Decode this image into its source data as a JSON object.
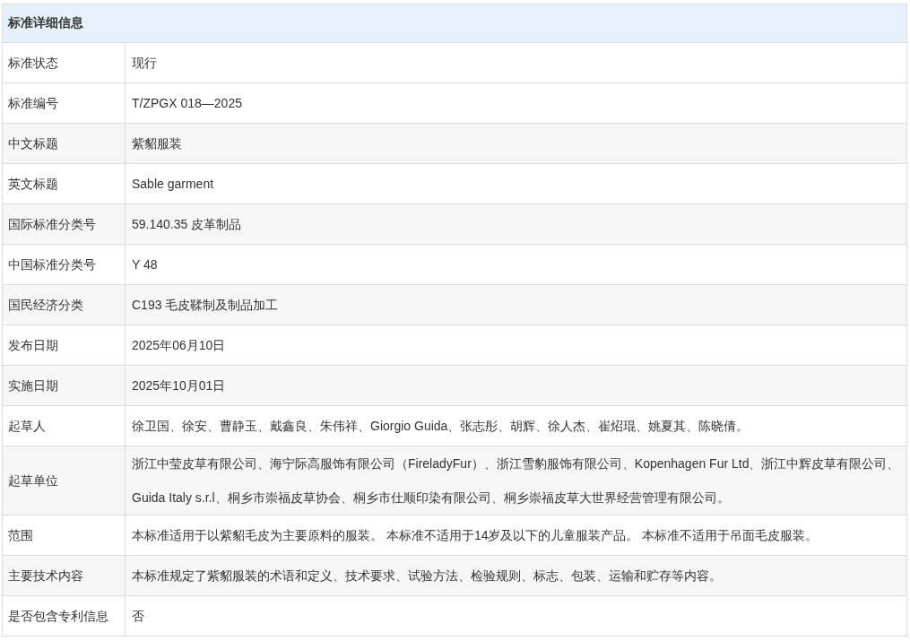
{
  "table": {
    "title": "标准详细信息",
    "rows": [
      {
        "label": "标准状态",
        "value": "现行"
      },
      {
        "label": "标准编号",
        "value": "T/ZPGX 018—2025"
      },
      {
        "label": "中文标题",
        "value": "紫貂服装"
      },
      {
        "label": "英文标题",
        "value": "Sable garment"
      },
      {
        "label": "国际标准分类号",
        "value": "59.140.35 皮革制品"
      },
      {
        "label": "中国标准分类号",
        "value": "Y 48"
      },
      {
        "label": "国民经济分类",
        "value": "C193 毛皮鞣制及制品加工"
      },
      {
        "label": "发布日期",
        "value": "2025年06月10日"
      },
      {
        "label": "实施日期",
        "value": "2025年10月01日"
      },
      {
        "label": "起草人",
        "value": "徐卫国、徐安、曹静玉、戴鑫良、朱伟祥、Giorgio Guida、张志彤、胡辉、徐人杰、崔炤琨、姚夏其、陈晓倩。"
      },
      {
        "label": "起草单位",
        "value": "浙江中莹皮草有限公司、海宁际高服饰有限公司（FireladyFur）、浙江雪豹服饰有限公司、Kopenhagen Fur Ltd、浙江中辉皮草有限公司、Guida Italy s.r.l、桐乡市崇福皮草协会、桐乡市仕顺印染有限公司、桐乡崇福皮草大世界经营管理有限公司。"
      },
      {
        "label": "范围",
        "value": "本标准适用于以紫貂毛皮为主要原料的服装。 本标准不适用于14岁及以下的儿童服装产品。 本标准不适用于吊面毛皮服装。"
      },
      {
        "label": "主要技术内容",
        "value": "本标准规定了紫貂服装的术语和定义、技术要求、试验方法、检验规则、标志、包装、运输和贮存等内容。"
      },
      {
        "label": "是否包含专利信息",
        "value": "否"
      }
    ]
  }
}
